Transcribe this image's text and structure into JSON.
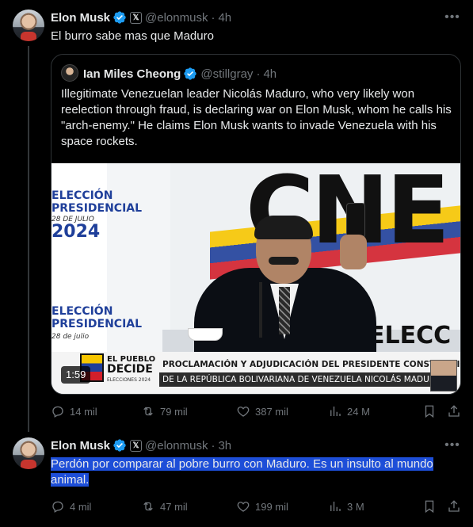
{
  "tweet1": {
    "author_name": "Elon Musk",
    "handle": "@elonmusk",
    "separator": "·",
    "time": "4h",
    "text": "El burro sabe mas que Maduro",
    "quote": {
      "author_name": "Ian Miles Cheong",
      "handle": "@stillgray",
      "separator": "·",
      "time": "4h",
      "text": "Illegitimate Venezuelan leader Nicolás Maduro, who very likely won reelection through fraud, is declaring war on Elon Musk, whom he calls his \"arch-enemy.\" He claims Elon Musk wants to invade Venezuela with his space rockets.",
      "video": {
        "duration": "1:59",
        "bg_text": "CNE",
        "poster_top_1": "ELECCIÓN",
        "poster_top_2": "PRESIDENCIAL",
        "poster_top_date": "28 DE JULIO",
        "poster_top_year": "2024",
        "poster_bottom_1": "ELECCIÓN",
        "poster_bottom_2": "PRESIDENCIAL",
        "poster_bottom_date": "28 de julio",
        "backdrop_text": "ELECC",
        "logo_line1": "EL PUEBLO",
        "logo_line2": "DECIDE",
        "logo_line3": "ELECCIONES 2024",
        "lower_third_line1": "PROCLAMACIÓN Y ADJUDICACIÓN DEL PRESIDENTE CONSTITUCIONAL",
        "lower_third_line2": "DE LA REPÚBLICA BOLIVARIANA DE VENEZUELA NICOLÁS MADURO"
      }
    },
    "replies": "14 mil",
    "reposts": "79 mil",
    "likes": "387 mil",
    "views": "24 M"
  },
  "tweet2": {
    "author_name": "Elon Musk",
    "handle": "@elonmusk",
    "separator": "·",
    "time": "3h",
    "text_line1": "Perdón por comparar al pobre burro con Maduro. Es un insulto al mundo",
    "text_line2": "animal.",
    "replies": "4 mil",
    "reposts": "47 mil",
    "likes": "199 mil",
    "views": "3 M"
  },
  "colors": {
    "background": "#000000",
    "text": "#e7e9ea",
    "muted": "#71767b",
    "verified": "#1d9bf0",
    "highlight": "#1d4ed8"
  },
  "icons": {
    "verified": "verified-badge-icon",
    "x_affiliate": "x-logo-icon",
    "more": "more-horizontal-icon",
    "reply": "reply-icon",
    "repost": "repost-icon",
    "like": "heart-icon",
    "views": "views-chart-icon",
    "bookmark": "bookmark-icon",
    "share": "share-icon"
  }
}
